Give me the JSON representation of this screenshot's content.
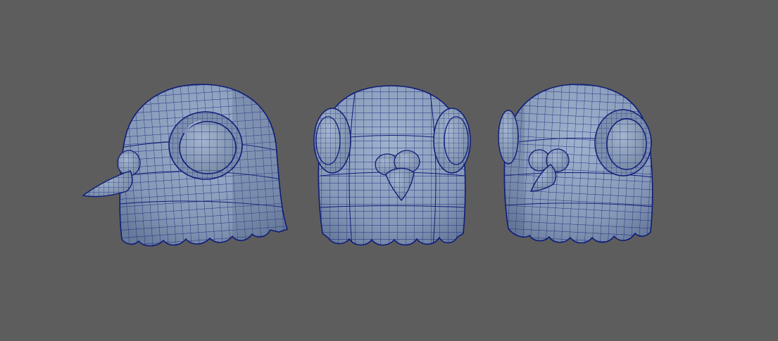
{
  "viewport": {
    "background_color": "#5d5d5d",
    "mesh_fill_color": "#8c9fbb",
    "mesh_shadow_color": "#6f83a3",
    "wire_color": "#0f1c78",
    "views": [
      {
        "id": "side",
        "orientation": "side"
      },
      {
        "id": "front",
        "orientation": "front"
      },
      {
        "id": "three-quarter",
        "orientation": "three-quarter"
      }
    ]
  }
}
